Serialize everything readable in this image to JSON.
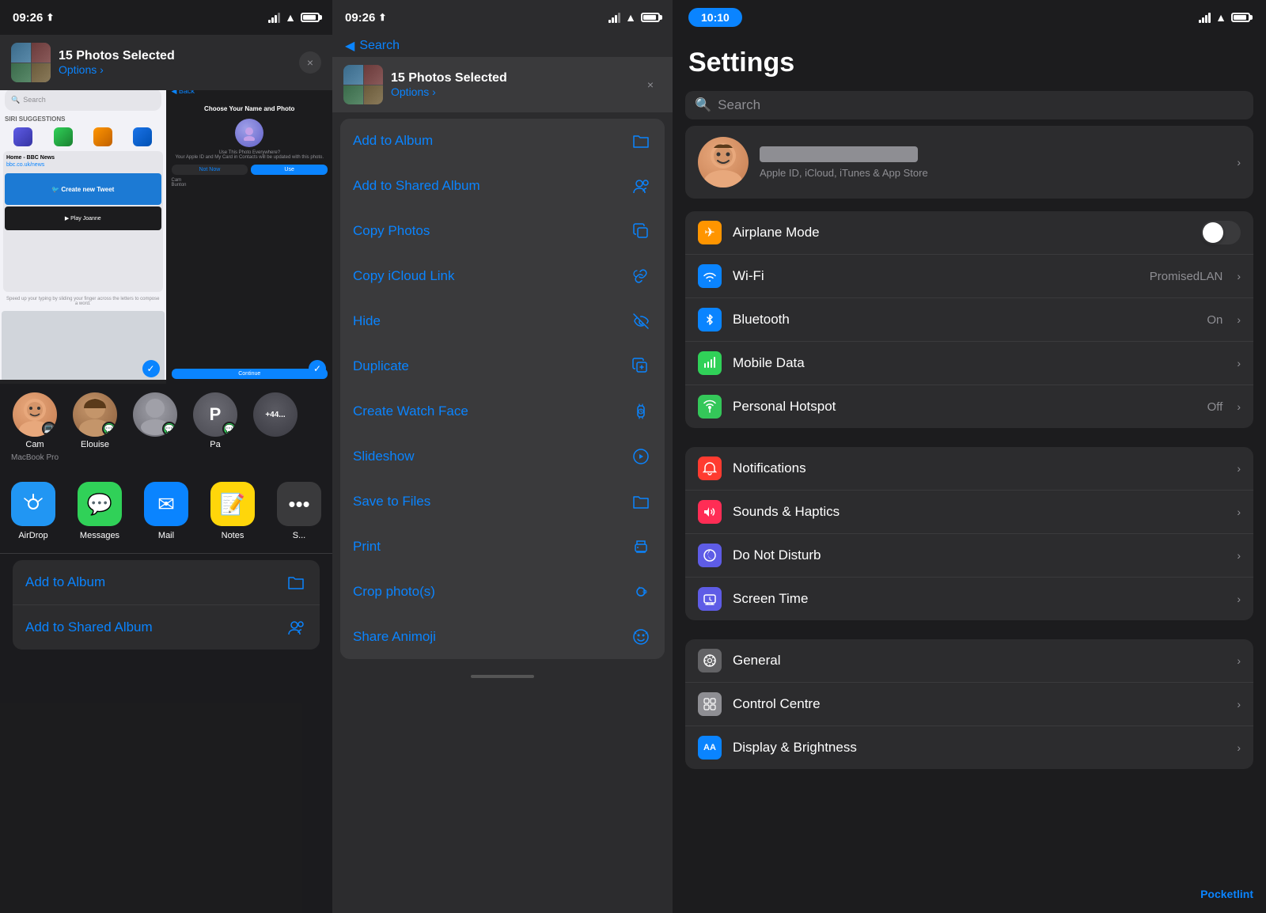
{
  "panel_left": {
    "status": {
      "time": "09:26",
      "location_icon": "◀",
      "search_back": "◀ Search"
    },
    "share_header": {
      "title": "15 Photos Selected",
      "options": "Options ›",
      "close": "×"
    },
    "contacts": [
      {
        "name": "Cam",
        "sub": "MacBook Pro",
        "badge_type": "macbook",
        "avatar_type": "cam"
      },
      {
        "name": "Elouise",
        "sub": "",
        "badge_type": "imessage",
        "avatar_type": "elouise"
      },
      {
        "name": "",
        "sub": "",
        "badge_type": "generic",
        "avatar_type": "generic1"
      },
      {
        "name": "Pa",
        "sub": "",
        "badge_type": "imessage",
        "avatar_type": "p"
      },
      {
        "name": "+44...",
        "sub": "",
        "badge_type": "none",
        "avatar_type": "more"
      }
    ],
    "apps": [
      {
        "name": "AirDrop",
        "type": "airdrop"
      },
      {
        "name": "Messages",
        "type": "messages"
      },
      {
        "name": "Mail",
        "type": "mail"
      },
      {
        "name": "Notes",
        "type": "notes"
      },
      {
        "name": "S...",
        "type": "more"
      }
    ],
    "menu_items": [
      {
        "label": "Add to Album",
        "icon": "🗂"
      },
      {
        "label": "Add to Shared Album",
        "icon": "👤"
      }
    ]
  },
  "panel_middle": {
    "status": {
      "time": "09:26"
    },
    "share_header": {
      "title": "15 Photos Selected",
      "options": "Options ›",
      "close": "×"
    },
    "menu_items": [
      {
        "label": "Add to Album",
        "icon": "folder"
      },
      {
        "label": "Add to Shared Album",
        "icon": "person.crop.rectangle"
      },
      {
        "label": "Copy Photos",
        "icon": "doc.on.doc"
      },
      {
        "label": "Copy iCloud Link",
        "icon": "link.icloud"
      },
      {
        "label": "Hide",
        "icon": "eye.slash"
      },
      {
        "label": "Duplicate",
        "icon": "plus.square.on.square"
      },
      {
        "label": "Create Watch Face",
        "icon": "applewatch"
      },
      {
        "label": "Slideshow",
        "icon": "play.circle"
      },
      {
        "label": "Save to Files",
        "icon": "folder"
      },
      {
        "label": "Print",
        "icon": "printer"
      },
      {
        "label": "Crop photo(s)",
        "icon": "camera"
      },
      {
        "label": "Share Animoji",
        "icon": "face.smiling"
      }
    ]
  },
  "panel_right": {
    "status": {
      "time": "10:10"
    },
    "title": "Settings",
    "search": {
      "placeholder": "Search"
    },
    "profile": {
      "sub": "Apple ID, iCloud, iTunes & App Store"
    },
    "sections": [
      {
        "items": [
          {
            "label": "Airplane Mode",
            "icon_type": "orange",
            "icon": "✈",
            "value": "",
            "has_toggle": true,
            "toggle_on": false
          },
          {
            "label": "Wi-Fi",
            "icon_type": "blue",
            "icon": "📶",
            "value": "PromisedLAN",
            "has_toggle": false
          },
          {
            "label": "Bluetooth",
            "icon_type": "blue-light",
            "icon": "B",
            "value": "On",
            "has_toggle": false
          },
          {
            "label": "Mobile Data",
            "icon_type": "green",
            "icon": "📡",
            "value": "",
            "has_toggle": false
          },
          {
            "label": "Personal Hotspot",
            "icon_type": "green-dark",
            "icon": "🔗",
            "value": "Off",
            "has_toggle": false
          }
        ]
      },
      {
        "items": [
          {
            "label": "Notifications",
            "icon_type": "red",
            "icon": "🔔",
            "value": "",
            "has_toggle": false
          },
          {
            "label": "Sounds & Haptics",
            "icon_type": "red-dark",
            "icon": "🔊",
            "value": "",
            "has_toggle": false
          },
          {
            "label": "Do Not Disturb",
            "icon_type": "indigo",
            "icon": "🌙",
            "value": "",
            "has_toggle": false
          },
          {
            "label": "Screen Time",
            "icon_type": "indigo",
            "icon": "⏱",
            "value": "",
            "has_toggle": false
          }
        ]
      },
      {
        "items": [
          {
            "label": "General",
            "icon_type": "gray",
            "icon": "⚙",
            "value": "",
            "has_toggle": false
          },
          {
            "label": "Control Centre",
            "icon_type": "gray-light",
            "icon": "⚏",
            "value": "",
            "has_toggle": false
          },
          {
            "label": "Display & Brightness",
            "icon_type": "aa",
            "icon": "AA",
            "value": "",
            "has_toggle": false
          }
        ]
      }
    ],
    "pocketlint": "Pocketlint"
  }
}
